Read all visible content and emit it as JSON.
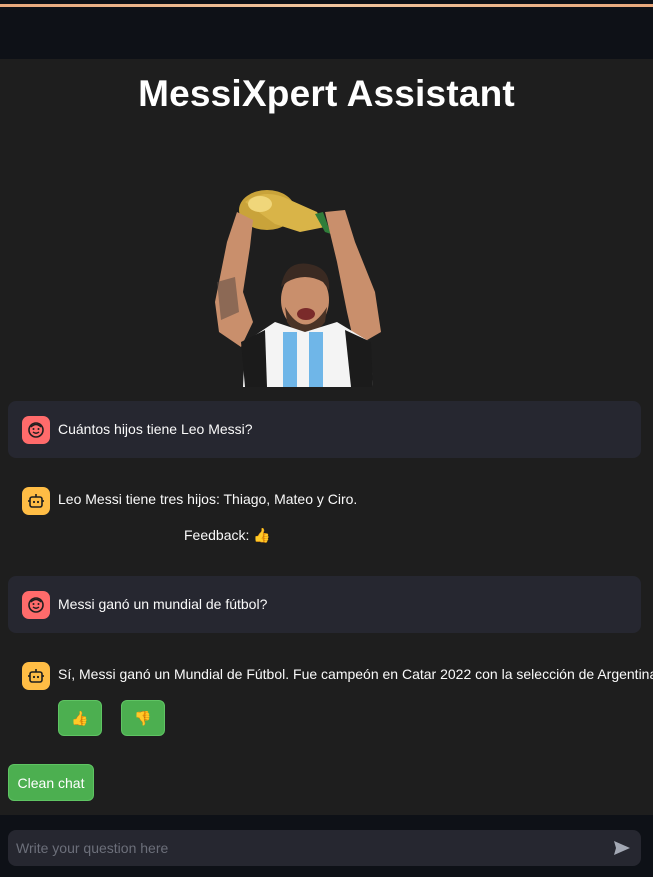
{
  "app": {
    "title": "MessiXpert Assistant",
    "accent_color": "#4caf50",
    "user_avatar_color": "#ff6b6b",
    "bot_avatar_color": "#ffbd45"
  },
  "hero_image": {
    "alt": "Messi lifting the World Cup trophy"
  },
  "messages": [
    {
      "role": "user",
      "text": "Cuántos hijos tiene Leo Messi?",
      "icon": "user-face-icon"
    },
    {
      "role": "assistant",
      "text": "Leo Messi tiene tres hijos: Thiago, Mateo y Ciro.",
      "icon": "robot-icon",
      "feedback_label": "Feedback: 👍"
    },
    {
      "role": "user",
      "text": "Messi ganó un mundial de fútbol?",
      "icon": "user-face-icon"
    },
    {
      "role": "assistant",
      "text": "Sí, Messi ganó un Mundial de Fútbol. Fue campeón en Catar 2022 con la selección de Argentina.",
      "icon": "robot-icon"
    }
  ],
  "feedback_buttons": {
    "up": "👍",
    "down": "👎"
  },
  "clean_button_label": "Clean chat",
  "chat_input": {
    "placeholder": "Write your question here",
    "value": ""
  }
}
